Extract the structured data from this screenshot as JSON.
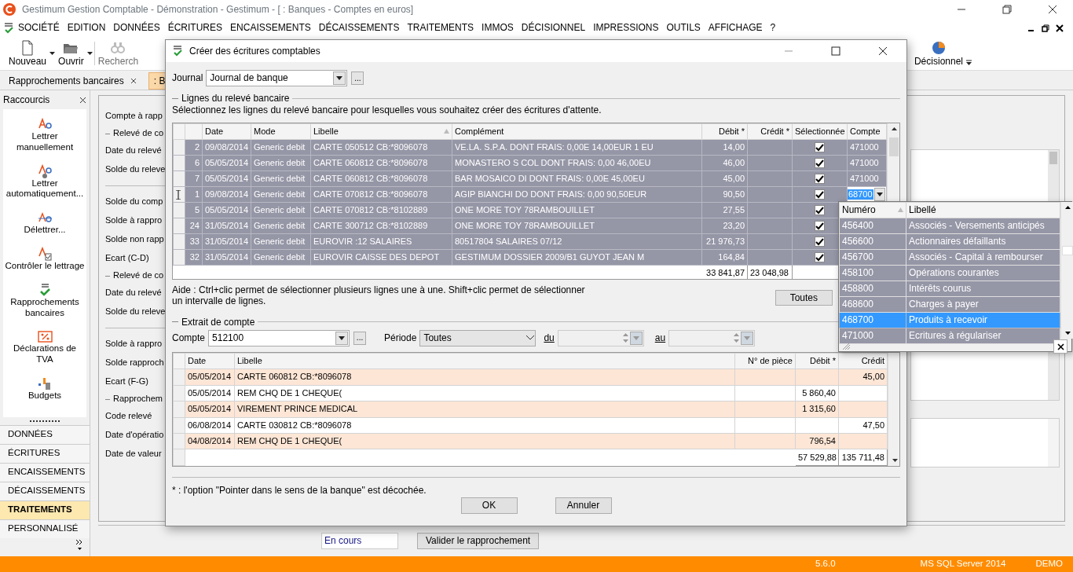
{
  "window": {
    "title": "Gestimum Gestion Comptable - Démonstration - Gestimum - [ : Banques - Comptes en euros]"
  },
  "menu": [
    "SOCIÉTÉ",
    "EDITION",
    "DONNÉES",
    "ÉCRITURES",
    "ENCAISSEMENTS",
    "DÉCAISSEMENTS",
    "TRAITEMENTS",
    "IMMOS",
    "DÉCISIONNEL",
    "IMPRESSIONS",
    "OUTILS",
    "AFFICHAGE",
    "?"
  ],
  "toolbar": [
    {
      "label": "Nouveau",
      "kind": "new",
      "disabled": false
    },
    {
      "label": "Ouvrir",
      "kind": "open",
      "disabled": false
    },
    {
      "label": "Recherch",
      "kind": "search",
      "disabled": true
    },
    {
      "label": "Décisionnel",
      "kind": "chart",
      "disabled": false
    }
  ],
  "tabs": [
    {
      "label": "Rapprochements bancaires",
      "selected": false
    },
    {
      "label": ": B",
      "selected": true
    }
  ],
  "sidebar": {
    "title": "Raccourcis",
    "shortcuts": [
      {
        "label": "Lettrer manuellement",
        "kind": "letter"
      },
      {
        "label": "Lettrer automatiquement...",
        "kind": "auto"
      },
      {
        "label": "Délettrer...",
        "kind": "unletter"
      },
      {
        "label": "Contrôler le lettrage",
        "kind": "control"
      },
      {
        "label": "Rapprochements bancaires",
        "kind": "reconcile"
      },
      {
        "label": "Déclarations de TVA",
        "kind": "vat"
      },
      {
        "label": "Budgets",
        "kind": "budget"
      }
    ],
    "sections": [
      {
        "label": "DONNÉES",
        "selected": false
      },
      {
        "label": "ÉCRITURES",
        "selected": false
      },
      {
        "label": "ENCAISSEMENTS",
        "selected": false
      },
      {
        "label": "DÉCAISSEMENTS",
        "selected": false
      },
      {
        "label": "TRAITEMENTS",
        "selected": true
      },
      {
        "label": "PERSONNALISÉ",
        "selected": false
      }
    ]
  },
  "form": {
    "fields": [
      {
        "kind": "label",
        "text": "Compte à rapp"
      },
      {
        "kind": "group",
        "text": "Relevé de co"
      },
      {
        "kind": "label",
        "text": "Date du relevé"
      },
      {
        "kind": "label",
        "text": "Solde du releve"
      },
      {
        "kind": "rule"
      },
      {
        "kind": "label",
        "text": "Solde du comp"
      },
      {
        "kind": "label",
        "text": "Solde à rappro"
      },
      {
        "kind": "label",
        "text": "Solde non rapp"
      },
      {
        "kind": "label",
        "text": "Ecart (C-D)"
      },
      {
        "kind": "group",
        "text": "Relevé de co"
      },
      {
        "kind": "label",
        "text": "Date du relevé"
      },
      {
        "kind": "label",
        "text": "Solde du releve"
      },
      {
        "kind": "rule"
      },
      {
        "kind": "label",
        "text": "Solde à rappro"
      },
      {
        "kind": "label",
        "text": "Solde rapproch"
      },
      {
        "kind": "label",
        "text": "Ecart (F-G)"
      },
      {
        "kind": "group",
        "text": "Rapprochem"
      },
      {
        "kind": "label",
        "text": "Code relevé"
      },
      {
        "kind": "label",
        "text": "Date d'opératio"
      },
      {
        "kind": "label",
        "text": "Date de valeur"
      }
    ],
    "status_value": "En cours",
    "validate_button": "Valider le rapprochement"
  },
  "dialog": {
    "title": "Créer des écritures comptables",
    "journal": {
      "label": "Journal",
      "value": "Journal de banque",
      "browse": "..."
    },
    "statement_section": "Lignes du relevé bancaire",
    "instruction": "Sélectionnez les lignes du relevé bancaire pour lesquelles vous souhaitez créer des écritures d'attente.",
    "statement_table": {
      "columns": [
        "Date",
        "Mode",
        "Libelle",
        "Complément",
        "Débit *",
        "Crédit *",
        "Sélectionnée",
        "Compte"
      ],
      "rows": [
        {
          "num": "2",
          "date": "09/08/2014",
          "mode": "Generic debit",
          "libelle": "CARTE 050512 CB:*8096078",
          "complement": "VE.LA. S.P.A. DONT FRAIS: 0,00E 14,00EUR 1 EU",
          "debit": "14,00",
          "selected": true,
          "checked": true,
          "editing": false,
          "compte": "471000"
        },
        {
          "num": "6",
          "date": "05/05/2014",
          "mode": "Generic debit",
          "libelle": "CARTE 060812 CB:*8096078",
          "complement": "MONASTERO S COL DONT FRAIS: 0,00 46,00EU",
          "debit": "46,00",
          "selected": true,
          "checked": true,
          "editing": false,
          "compte": "471000"
        },
        {
          "num": "7",
          "date": "05/05/2014",
          "mode": "Generic debit",
          "libelle": "CARTE 060812 CB:*8096078",
          "complement": "BAR MOSAICO DI DONT FRAIS: 0,00E 45,00EU",
          "debit": "45,00",
          "selected": true,
          "checked": true,
          "editing": false,
          "compte": "471000"
        },
        {
          "num": "1",
          "date": "09/08/2014",
          "mode": "Generic debit",
          "libelle": "CARTE 070812 CB:*8096078",
          "complement": "AGIP BIANCHI DO DONT FRAIS: 0,00 90,50EUR",
          "debit": "90,50",
          "selected": true,
          "checked": true,
          "editing": true,
          "compte": "68700"
        },
        {
          "num": "5",
          "date": "05/05/2014",
          "mode": "Generic debit",
          "libelle": "CARTE 070812 CB:*8102889",
          "complement": "ONE MORE TOY 78RAMBOUILLET",
          "debit": "27,55",
          "selected": true,
          "checked": true,
          "editing": false
        },
        {
          "num": "24",
          "date": "31/05/2014",
          "mode": "Generic debit",
          "libelle": "CARTE 300712 CB:*8102889",
          "complement": "ONE MORE TOY 78RAMBOUILLET",
          "debit": "23,20",
          "selected": true,
          "checked": true,
          "editing": false
        },
        {
          "num": "33",
          "date": "31/05/2014",
          "mode": "Generic debit",
          "libelle": "EUROVIR :12 SALAIRES",
          "complement": "80517804 SALAIRES 07/12",
          "debit": "21 976,73",
          "selected": true,
          "checked": true,
          "editing": false
        },
        {
          "num": "32",
          "date": "31/05/2014",
          "mode": "Generic debit",
          "libelle": "EUROVIR CAISSE DES DEPOT",
          "complement": "GESTIMUM DOSSIER 2009/B1 GUYOT JEAN M",
          "debit": "164,84",
          "selected": true,
          "checked": true,
          "editing": false
        }
      ],
      "total_debit": "33 841,87",
      "total_credit": "23 048,98"
    },
    "help": "Aide : Ctrl+clic permet de sélectionner plusieurs lignes une à une. Shift+clic permet de sélectionner\nun intervalle de lignes.",
    "all_button": "Toutes",
    "extract_section": "Extrait de compte",
    "account": {
      "label": "Compte",
      "value": "512100",
      "browse": "..."
    },
    "period": {
      "label": "Période",
      "value": "Toutes",
      "from_label": "du",
      "to_label": "au"
    },
    "extract_table": {
      "columns": [
        "Date",
        "Libelle",
        "N° de pièce",
        "Débit *",
        "Crédit"
      ],
      "rows": [
        {
          "date": "05/05/2014",
          "libelle": "CARTE 060812 CB:*8096078",
          "credit": "45,00",
          "highlighted": true
        },
        {
          "date": "05/05/2014",
          "libelle": "REM CHQ DE 1 CHEQUE(",
          "debit": "5 860,40",
          "highlighted": false
        },
        {
          "date": "05/05/2014",
          "libelle": "VIREMENT PRINCE MEDICAL",
          "debit": "1 315,60",
          "highlighted": true
        },
        {
          "date": "06/08/2014",
          "libelle": "CARTE 030812 CB:*8096078",
          "credit": "47,50",
          "highlighted": false
        },
        {
          "date": "04/08/2014",
          "libelle": "REM CHQ DE 1 CHEQUE(",
          "debit": "796,54",
          "highlighted": true
        }
      ],
      "total_debit": "57 529,88",
      "total_credit": "135 711,48"
    },
    "footnote": "* : l'option \"Pointer dans le sens de la banque\" est décochée.",
    "buttons": [
      "OK",
      "Annuler"
    ]
  },
  "account_popup": {
    "columns": [
      "Numéro",
      "Libellé"
    ],
    "rows": [
      {
        "number": "456400",
        "label": "Associés - Versements anticipés",
        "selected": false
      },
      {
        "number": "456600",
        "label": "Actionnaires défaillants",
        "selected": false
      },
      {
        "number": "456700",
        "label": "Associés - Capital à rembourser",
        "selected": false
      },
      {
        "number": "458100",
        "label": "Opérations courantes",
        "selected": false
      },
      {
        "number": "458800",
        "label": "Intérêts courus",
        "selected": false
      },
      {
        "number": "468600",
        "label": "Charges à payer",
        "selected": false
      },
      {
        "number": "468700",
        "label": "Produits à recevoir",
        "selected": true
      },
      {
        "number": "471000",
        "label": "Ecritures à régulariser",
        "selected": false
      }
    ]
  },
  "status_bar": [
    "5.6.0",
    "MS SQL Server 2014",
    "DEMO"
  ]
}
